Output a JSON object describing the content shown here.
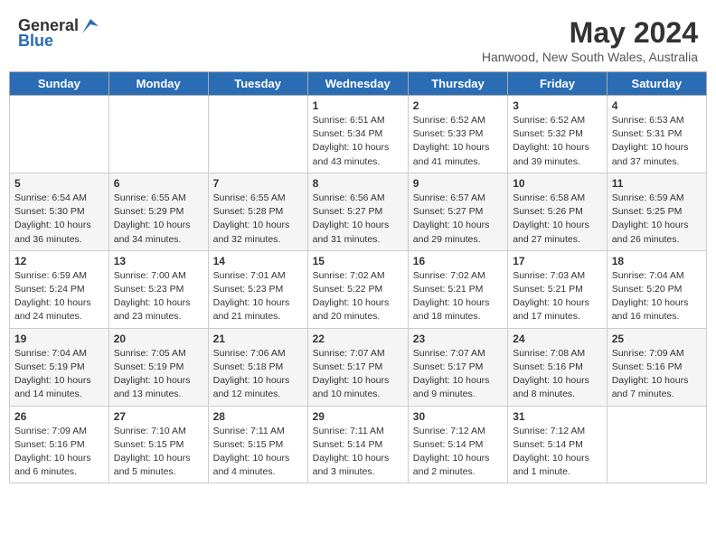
{
  "header": {
    "logo_general": "General",
    "logo_blue": "Blue",
    "title": "May 2024",
    "subtitle": "Hanwood, New South Wales, Australia"
  },
  "weekdays": [
    "Sunday",
    "Monday",
    "Tuesday",
    "Wednesday",
    "Thursday",
    "Friday",
    "Saturday"
  ],
  "weeks": [
    [
      {
        "day": "",
        "info": ""
      },
      {
        "day": "",
        "info": ""
      },
      {
        "day": "",
        "info": ""
      },
      {
        "day": "1",
        "info": "Sunrise: 6:51 AM\nSunset: 5:34 PM\nDaylight: 10 hours\nand 43 minutes."
      },
      {
        "day": "2",
        "info": "Sunrise: 6:52 AM\nSunset: 5:33 PM\nDaylight: 10 hours\nand 41 minutes."
      },
      {
        "day": "3",
        "info": "Sunrise: 6:52 AM\nSunset: 5:32 PM\nDaylight: 10 hours\nand 39 minutes."
      },
      {
        "day": "4",
        "info": "Sunrise: 6:53 AM\nSunset: 5:31 PM\nDaylight: 10 hours\nand 37 minutes."
      }
    ],
    [
      {
        "day": "5",
        "info": "Sunrise: 6:54 AM\nSunset: 5:30 PM\nDaylight: 10 hours\nand 36 minutes."
      },
      {
        "day": "6",
        "info": "Sunrise: 6:55 AM\nSunset: 5:29 PM\nDaylight: 10 hours\nand 34 minutes."
      },
      {
        "day": "7",
        "info": "Sunrise: 6:55 AM\nSunset: 5:28 PM\nDaylight: 10 hours\nand 32 minutes."
      },
      {
        "day": "8",
        "info": "Sunrise: 6:56 AM\nSunset: 5:27 PM\nDaylight: 10 hours\nand 31 minutes."
      },
      {
        "day": "9",
        "info": "Sunrise: 6:57 AM\nSunset: 5:27 PM\nDaylight: 10 hours\nand 29 minutes."
      },
      {
        "day": "10",
        "info": "Sunrise: 6:58 AM\nSunset: 5:26 PM\nDaylight: 10 hours\nand 27 minutes."
      },
      {
        "day": "11",
        "info": "Sunrise: 6:59 AM\nSunset: 5:25 PM\nDaylight: 10 hours\nand 26 minutes."
      }
    ],
    [
      {
        "day": "12",
        "info": "Sunrise: 6:59 AM\nSunset: 5:24 PM\nDaylight: 10 hours\nand 24 minutes."
      },
      {
        "day": "13",
        "info": "Sunrise: 7:00 AM\nSunset: 5:23 PM\nDaylight: 10 hours\nand 23 minutes."
      },
      {
        "day": "14",
        "info": "Sunrise: 7:01 AM\nSunset: 5:23 PM\nDaylight: 10 hours\nand 21 minutes."
      },
      {
        "day": "15",
        "info": "Sunrise: 7:02 AM\nSunset: 5:22 PM\nDaylight: 10 hours\nand 20 minutes."
      },
      {
        "day": "16",
        "info": "Sunrise: 7:02 AM\nSunset: 5:21 PM\nDaylight: 10 hours\nand 18 minutes."
      },
      {
        "day": "17",
        "info": "Sunrise: 7:03 AM\nSunset: 5:21 PM\nDaylight: 10 hours\nand 17 minutes."
      },
      {
        "day": "18",
        "info": "Sunrise: 7:04 AM\nSunset: 5:20 PM\nDaylight: 10 hours\nand 16 minutes."
      }
    ],
    [
      {
        "day": "19",
        "info": "Sunrise: 7:04 AM\nSunset: 5:19 PM\nDaylight: 10 hours\nand 14 minutes."
      },
      {
        "day": "20",
        "info": "Sunrise: 7:05 AM\nSunset: 5:19 PM\nDaylight: 10 hours\nand 13 minutes."
      },
      {
        "day": "21",
        "info": "Sunrise: 7:06 AM\nSunset: 5:18 PM\nDaylight: 10 hours\nand 12 minutes."
      },
      {
        "day": "22",
        "info": "Sunrise: 7:07 AM\nSunset: 5:17 PM\nDaylight: 10 hours\nand 10 minutes."
      },
      {
        "day": "23",
        "info": "Sunrise: 7:07 AM\nSunset: 5:17 PM\nDaylight: 10 hours\nand 9 minutes."
      },
      {
        "day": "24",
        "info": "Sunrise: 7:08 AM\nSunset: 5:16 PM\nDaylight: 10 hours\nand 8 minutes."
      },
      {
        "day": "25",
        "info": "Sunrise: 7:09 AM\nSunset: 5:16 PM\nDaylight: 10 hours\nand 7 minutes."
      }
    ],
    [
      {
        "day": "26",
        "info": "Sunrise: 7:09 AM\nSunset: 5:16 PM\nDaylight: 10 hours\nand 6 minutes."
      },
      {
        "day": "27",
        "info": "Sunrise: 7:10 AM\nSunset: 5:15 PM\nDaylight: 10 hours\nand 5 minutes."
      },
      {
        "day": "28",
        "info": "Sunrise: 7:11 AM\nSunset: 5:15 PM\nDaylight: 10 hours\nand 4 minutes."
      },
      {
        "day": "29",
        "info": "Sunrise: 7:11 AM\nSunset: 5:14 PM\nDaylight: 10 hours\nand 3 minutes."
      },
      {
        "day": "30",
        "info": "Sunrise: 7:12 AM\nSunset: 5:14 PM\nDaylight: 10 hours\nand 2 minutes."
      },
      {
        "day": "31",
        "info": "Sunrise: 7:12 AM\nSunset: 5:14 PM\nDaylight: 10 hours\nand 1 minute."
      },
      {
        "day": "",
        "info": ""
      }
    ]
  ]
}
